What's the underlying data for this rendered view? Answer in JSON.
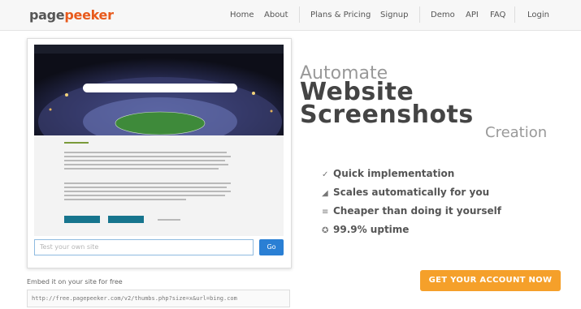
{
  "header": {
    "logo_part1": "page",
    "logo_part2": "peeker",
    "nav": [
      "Home",
      "About",
      "Plans & Pricing",
      "Signup",
      "Demo",
      "API",
      "FAQ",
      "Login"
    ]
  },
  "preview": {
    "input_placeholder": "Test your own site",
    "go_label": "Go"
  },
  "embed": {
    "label": "Embed it on your site for free",
    "code": "http://free.pagepeeker.com/v2/thumbs.php?size=x&url=bing.com"
  },
  "headline": {
    "line1": "Automate",
    "line2": "Website",
    "line3": "Screenshots",
    "line4": "Creation"
  },
  "features": [
    {
      "icon": "pencil-icon",
      "glyph": "✓",
      "text": "Quick implementation"
    },
    {
      "icon": "chart-icon",
      "glyph": "◢",
      "text": "Scales automatically for you"
    },
    {
      "icon": "list-icon",
      "glyph": "≡",
      "text": "Cheaper than doing it yourself"
    },
    {
      "icon": "circle-icon",
      "glyph": "✪",
      "text": "99.9% uptime"
    }
  ],
  "cta": {
    "label": "GET YOUR ACCOUNT NOW"
  },
  "colors": {
    "brand_orange": "#e85a1c",
    "cta": "#f5a02a",
    "go_button": "#2a7fd4"
  }
}
